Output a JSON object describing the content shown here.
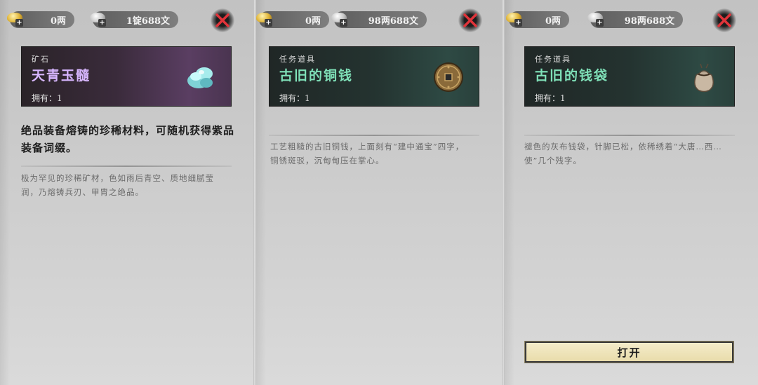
{
  "panels": [
    {
      "currency": {
        "gold_value": "0两",
        "silver_value": "1锭688文"
      },
      "item": {
        "category": "矿石",
        "name": "天青玉髓",
        "owned": "拥有：1",
        "description": "绝品装备熔铸的珍稀材料，可随机获得紫品装备词缀。",
        "lore": "极为罕见的珍稀矿材，色如雨后青空、质地细腻莹润，乃熔铸兵刃、甲胄之绝品。",
        "icon": "jade-ore-icon"
      }
    },
    {
      "currency": {
        "gold_value": "0两",
        "silver_value": "98两688文"
      },
      "item": {
        "category": "任务道具",
        "name": "古旧的铜钱",
        "owned": "拥有：1",
        "lore": "工艺粗糙的古旧铜钱，上面刻有“建中通宝”四字，铜锈斑驳，沉甸甸压在掌心。",
        "icon": "copper-coin-icon"
      }
    },
    {
      "currency": {
        "gold_value": "0两",
        "silver_value": "98两688文"
      },
      "item": {
        "category": "任务道具",
        "name": "古旧的钱袋",
        "owned": "拥有：1",
        "lore": "褪色的灰布钱袋，针脚已松，依稀绣着“大唐…西…使”几个残字。",
        "icon": "coin-pouch-icon"
      },
      "action_label": "打开"
    }
  ],
  "colors": {
    "purple_name": "#d7b6ff",
    "teal_name": "#7fe0b8",
    "close_red": "#e0343a"
  }
}
